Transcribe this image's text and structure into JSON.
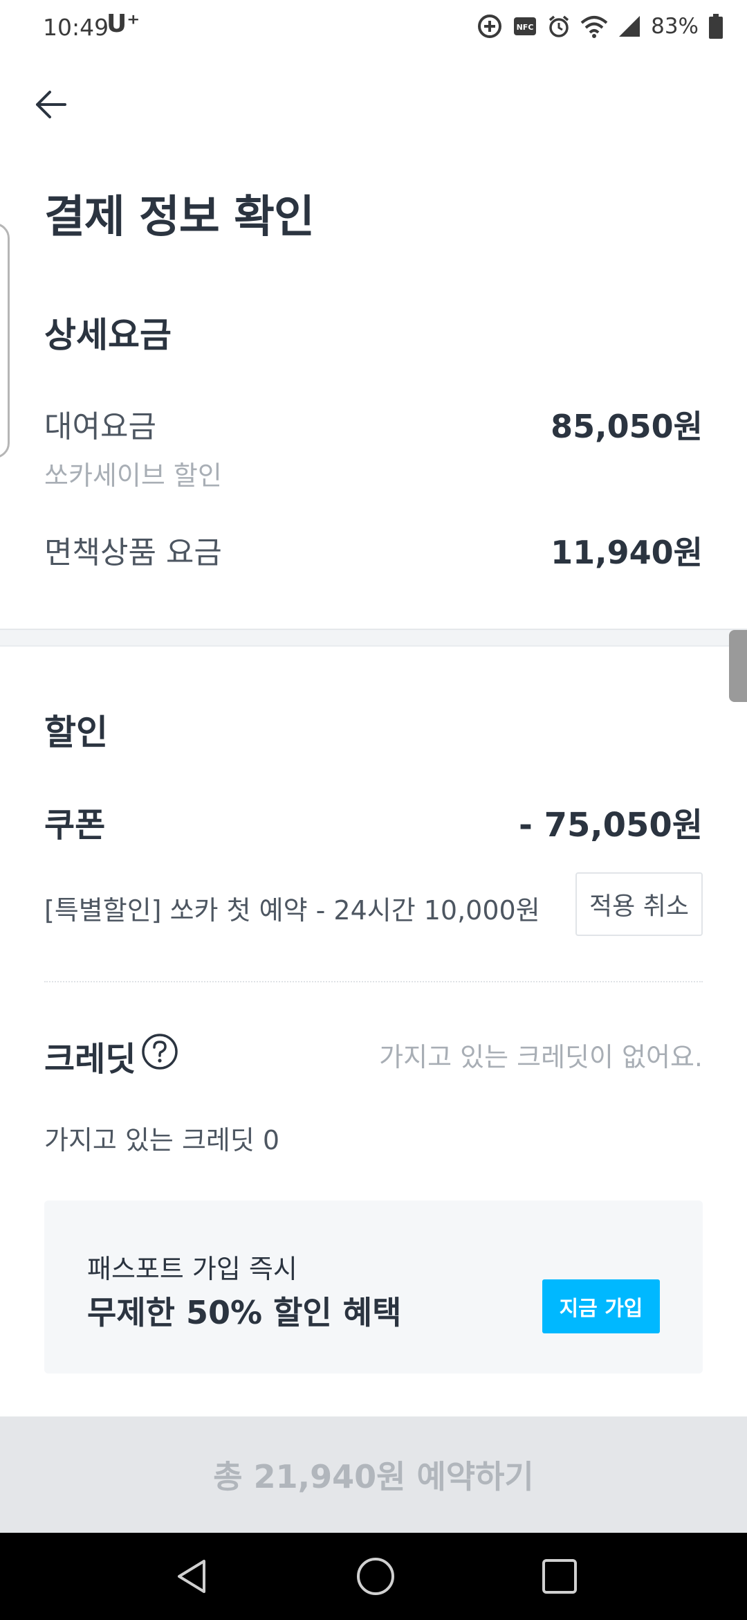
{
  "status_bar": {
    "time": "10:49",
    "carrier": "U⁺",
    "battery": "83%",
    "icons": [
      "data-saver-icon",
      "nfc-icon",
      "alarm-icon",
      "wifi-icon",
      "signal-icon",
      "battery-icon"
    ]
  },
  "header": {
    "back_icon": "arrow-left-icon",
    "title": "결제 정보 확인"
  },
  "detail_fee": {
    "title": "상세요금",
    "rental_label": "대여요금",
    "rental_value": "85,050원",
    "rental_sub": "쏘카세이브 할인",
    "insurance_label": "면책상품 요금",
    "insurance_value": "11,940원"
  },
  "discount": {
    "title": "할인",
    "coupon_label": "쿠폰",
    "coupon_value": "- 75,050원",
    "coupon_desc": "[특별할인] 쏘카 첫 예약 - 24시간 10,000원",
    "cancel_label": "적용 취소",
    "credit_label": "크레딧",
    "credit_empty": "가지고 있는 크레딧이 없어요.",
    "credit_owned": "가지고 있는 크레딧 0"
  },
  "promo": {
    "line1": "패스포트 가입 즉시",
    "line2": "무제한 50% 할인 혜택",
    "button": "지금 가입"
  },
  "cta": {
    "label": "총 21,940원 예약하기"
  },
  "colors": {
    "accent": "#00b8ff",
    "text_primary": "#2b3440",
    "text_muted": "#a8aeb5",
    "cta_disabled_bg": "#e4e6e9"
  }
}
